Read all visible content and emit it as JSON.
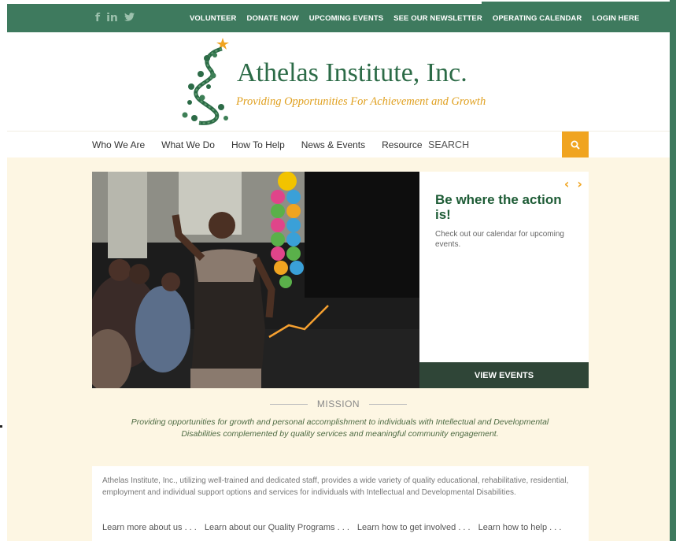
{
  "topbar": {
    "social": [
      "f",
      "in",
      "✦"
    ],
    "links": [
      "VOLUNTEER",
      "DONATE NOW",
      "UPCOMING EVENTS",
      "SEE OUR NEWSLETTER",
      "OPERATING CALENDAR",
      "LOGIN HERE"
    ]
  },
  "header": {
    "brand": "Athelas Institute, Inc.",
    "tagline": "Providing Opportunities For Achievement and Growth"
  },
  "nav": {
    "items": [
      "Who We Are",
      "What We Do",
      "How To Help",
      "News & Events",
      "Resources"
    ],
    "search_placeholder": "SEARCH"
  },
  "hero": {
    "title": "Be where the action is!",
    "text": "Check out our calendar for upcoming events.",
    "button": "VIEW EVENTS",
    "prev_arrow": "‹",
    "next_arrow": "›"
  },
  "mission": {
    "heading": "MISSION",
    "text": "Providing opportunities for growth and personal accomplishment to individuals with Intellectual and Developmental Disabilities complemented by quality services and meaningful community engagement."
  },
  "about": {
    "text": "Athelas Institute, Inc., utilizing well-trained and dedicated staff, provides a wide variety of quality educational, rehabilitative, residential, employment and individual support options and services for individuals with Intellectual and Developmental Disabilities.",
    "links": [
      "Learn more about us . . .",
      "Learn about our Quality Programs . . .",
      "Learn how to get involved . . .",
      "Learn how to help . . ."
    ]
  },
  "colors": {
    "brand_green": "#3e7a5e",
    "accent_orange": "#f0a420",
    "cream": "#fdf6e3"
  }
}
